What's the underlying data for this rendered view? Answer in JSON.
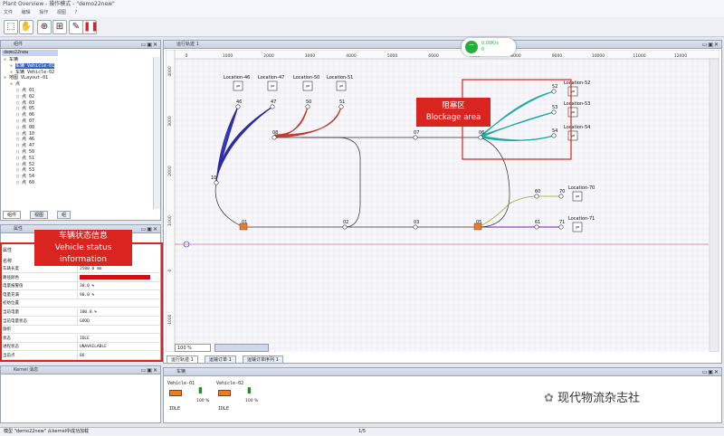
{
  "window": {
    "title": "Plant Overview - 操作模式 - \"demo22new\""
  },
  "menu": [
    "文件",
    "编辑",
    "操作",
    "视图",
    "?"
  ],
  "toolbar": {
    "icons": [
      "select-icon",
      "hand-icon",
      "zoom-icon",
      "route-icon",
      "pause-icon"
    ]
  },
  "components_panel": {
    "title": "组件",
    "model_name": "demo22new",
    "tree": [
      {
        "label": "车辆",
        "depth": 0
      },
      {
        "label": "车辆 Vehicle-01",
        "depth": 1,
        "selected": true
      },
      {
        "label": "车辆 Vehicle-02",
        "depth": 1
      },
      {
        "label": "地图 VLayout-01",
        "depth": 0
      },
      {
        "label": "点",
        "depth": 1
      },
      {
        "label": "点 01",
        "depth": 2
      },
      {
        "label": "点 02",
        "depth": 2
      },
      {
        "label": "点 03",
        "depth": 2
      },
      {
        "label": "点 05",
        "depth": 2
      },
      {
        "label": "点 06",
        "depth": 2
      },
      {
        "label": "点 07",
        "depth": 2
      },
      {
        "label": "点 08",
        "depth": 2
      },
      {
        "label": "点 10",
        "depth": 2
      },
      {
        "label": "点 46",
        "depth": 2
      },
      {
        "label": "点 47",
        "depth": 2
      },
      {
        "label": "点 50",
        "depth": 2
      },
      {
        "label": "点 51",
        "depth": 2
      },
      {
        "label": "点 52",
        "depth": 2
      },
      {
        "label": "点 53",
        "depth": 2
      },
      {
        "label": "点 54",
        "depth": 2
      },
      {
        "label": "点 60",
        "depth": 2
      }
    ],
    "tabs": [
      "组件",
      "视图",
      "组"
    ]
  },
  "properties_panel": {
    "title": "属性",
    "header_label": "属性",
    "column_name": "名称",
    "rows": [
      {
        "k": "车辆长度",
        "v": "2500.0 mm"
      },
      {
        "k": "路径颜色",
        "v": ""
      },
      {
        "k": "电量报警值",
        "v": "30.0 %"
      },
      {
        "k": "电量充满",
        "v": "90.0 %"
      },
      {
        "k": "初始位置",
        "v": ""
      },
      {
        "k": "当前电量",
        "v": "100.0 %"
      },
      {
        "k": "当前电量状态",
        "v": "GOOD"
      },
      {
        "k": "旗帜",
        "v": ""
      },
      {
        "k": "状态",
        "v": "IDLE"
      },
      {
        "k": "进程状态",
        "v": "UNAVAILABLE"
      },
      {
        "k": "当前点",
        "v": "06"
      }
    ],
    "path_color": "#cc1111"
  },
  "kernel_panel": {
    "title": "Kernel 消息"
  },
  "callout_vehicle": {
    "line1": "车辆状态信息",
    "line2": "Vehicle status",
    "line3": "information"
  },
  "callout_blockage": {
    "line1": "阻塞区",
    "line2": "Blockage area"
  },
  "map_panel": {
    "tabs": [
      "运行轨迹 1",
      "运输订单 1",
      "运输订单序列 1"
    ],
    "zoom": "100 %",
    "x_ticks": [
      "0",
      "1000",
      "2000",
      "3000",
      "4000",
      "5000",
      "6000",
      "7000",
      "8000",
      "9000",
      "10000",
      "11000",
      "12000"
    ],
    "y_ticks": [
      "4000",
      "3000",
      "2000",
      "1000",
      "0",
      "-1000",
      "-2000",
      "-3000"
    ]
  },
  "network": {
    "speed": "0.00K/s",
    "count": "0"
  },
  "vehicles_panel": {
    "title": "车辆",
    "vehicles": [
      {
        "name": "Vehicle-01",
        "battery": "100 %",
        "state": "IDLE"
      },
      {
        "name": "Vehicle-02",
        "battery": "100 %",
        "state": "IDLE"
      }
    ]
  },
  "statusbar": {
    "message": "模型 \"demo22new\" 从kernel中成功加载",
    "page": "1/5"
  },
  "watermark": {
    "text": "现代物流杂志社"
  },
  "chart_data": {
    "type": "diagram",
    "points": [
      {
        "id": "01"
      },
      {
        "id": "02"
      },
      {
        "id": "03"
      },
      {
        "id": "05"
      },
      {
        "id": "06"
      },
      {
        "id": "07"
      },
      {
        "id": "08"
      },
      {
        "id": "10"
      },
      {
        "id": "46"
      },
      {
        "id": "47"
      },
      {
        "id": "50"
      },
      {
        "id": "51"
      },
      {
        "id": "52"
      },
      {
        "id": "53"
      },
      {
        "id": "54"
      },
      {
        "id": "60"
      },
      {
        "id": "61"
      },
      {
        "id": "70"
      },
      {
        "id": "71"
      }
    ],
    "locations": [
      "Location-46",
      "Location-47",
      "Location-50",
      "Location-51",
      "Location-52",
      "Location-53",
      "Location-54",
      "Location-70",
      "Location-71"
    ],
    "colors": {
      "blue_routes": "#2a2aa8",
      "red_routes": "#c0392b",
      "teal_routes": "#1aa9a4",
      "callout": "#d9241f"
    }
  }
}
